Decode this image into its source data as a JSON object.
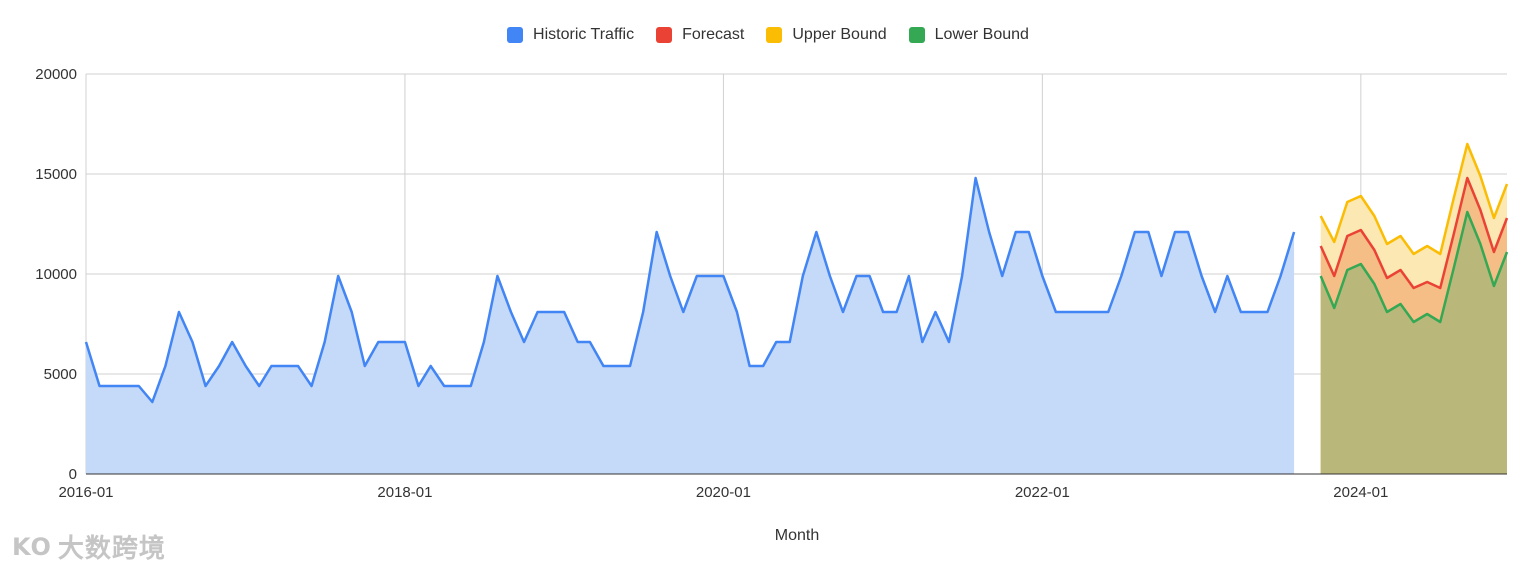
{
  "chart_data": {
    "type": "area",
    "xlabel": "Month",
    "ylabel": "",
    "ylim": [
      0,
      20000
    ],
    "yticks": [
      "0",
      "5000",
      "10000",
      "15000",
      "20000"
    ],
    "xticks": [
      "2016-01",
      "2018-01",
      "2020-01",
      "2022-01",
      "2024-01"
    ],
    "grid": true,
    "legend_position": "top",
    "series": [
      {
        "name": "Historic Traffic",
        "color": "#4285F4",
        "fill": "#C5D9F8",
        "x": [
          "2016-01",
          "2016-02",
          "2016-03",
          "2016-04",
          "2016-05",
          "2016-06",
          "2016-07",
          "2016-08",
          "2016-09",
          "2016-10",
          "2016-11",
          "2016-12",
          "2017-01",
          "2017-02",
          "2017-03",
          "2017-04",
          "2017-05",
          "2017-06",
          "2017-07",
          "2017-08",
          "2017-09",
          "2017-10",
          "2017-11",
          "2017-12",
          "2018-01",
          "2018-02",
          "2018-03",
          "2018-04",
          "2018-05",
          "2018-06",
          "2018-07",
          "2018-08",
          "2018-09",
          "2018-10",
          "2018-11",
          "2018-12",
          "2019-01",
          "2019-02",
          "2019-03",
          "2019-04",
          "2019-05",
          "2019-06",
          "2019-07",
          "2019-08",
          "2019-09",
          "2019-10",
          "2019-11",
          "2019-12",
          "2020-01",
          "2020-02",
          "2020-03",
          "2020-04",
          "2020-05",
          "2020-06",
          "2020-07",
          "2020-08",
          "2020-09",
          "2020-10",
          "2020-11",
          "2020-12",
          "2021-01",
          "2021-02",
          "2021-03",
          "2021-04",
          "2021-05",
          "2021-06",
          "2021-07",
          "2021-08",
          "2021-09",
          "2021-10",
          "2021-11",
          "2021-12",
          "2022-01",
          "2022-02",
          "2022-03",
          "2022-04",
          "2022-05",
          "2022-06",
          "2022-07",
          "2022-08",
          "2022-09",
          "2022-10",
          "2022-11",
          "2022-12",
          "2023-01",
          "2023-02",
          "2023-03",
          "2023-04",
          "2023-05",
          "2023-06",
          "2023-07",
          "2023-08"
        ],
        "values": [
          6600,
          4400,
          4400,
          4400,
          4400,
          3600,
          5400,
          8100,
          6600,
          4400,
          5400,
          6600,
          5400,
          4400,
          5400,
          5400,
          5400,
          4400,
          6600,
          9900,
          8100,
          5400,
          6600,
          6600,
          6600,
          4400,
          5400,
          4400,
          4400,
          4400,
          6600,
          9900,
          8100,
          6600,
          8100,
          8100,
          8100,
          6600,
          6600,
          5400,
          5400,
          5400,
          8100,
          12100,
          9900,
          8100,
          9900,
          9900,
          9900,
          8100,
          5400,
          5400,
          6600,
          6600,
          9900,
          12100,
          9900,
          8100,
          9900,
          9900,
          8100,
          8100,
          9900,
          6600,
          8100,
          6600,
          9900,
          14800,
          12100,
          9900,
          12100,
          12100,
          9900,
          8100,
          8100,
          8100,
          8100,
          8100,
          9900,
          12100,
          12100,
          9900,
          12100,
          12100,
          9900,
          8100,
          9900,
          8100,
          8100,
          8100,
          9900,
          12100
        ]
      },
      {
        "name": "Forecast",
        "color": "#EA4335",
        "fill": "#F5BE86",
        "x": [
          "2023-10",
          "2023-11",
          "2023-12",
          "2024-01",
          "2024-02",
          "2024-03",
          "2024-04",
          "2024-05",
          "2024-06",
          "2024-07",
          "2024-08",
          "2024-09",
          "2024-10",
          "2024-11",
          "2024-12"
        ],
        "values": [
          11400,
          9900,
          11900,
          12200,
          11200,
          9800,
          10200,
          9300,
          9600,
          9300,
          12000,
          14800,
          13200,
          11100,
          12800
        ]
      },
      {
        "name": "Upper Bound",
        "color": "#FBBC04",
        "fill": "#FCE8B2",
        "x": [
          "2023-10",
          "2023-11",
          "2023-12",
          "2024-01",
          "2024-02",
          "2024-03",
          "2024-04",
          "2024-05",
          "2024-06",
          "2024-07",
          "2024-08",
          "2024-09",
          "2024-10",
          "2024-11",
          "2024-12"
        ],
        "values": [
          12900,
          11600,
          13600,
          13900,
          12900,
          11500,
          11900,
          11000,
          11400,
          11000,
          13800,
          16500,
          14900,
          12800,
          14500
        ]
      },
      {
        "name": "Lower Bound",
        "color": "#34A853",
        "fill": "#B9B87A",
        "x": [
          "2023-10",
          "2023-11",
          "2023-12",
          "2024-01",
          "2024-02",
          "2024-03",
          "2024-04",
          "2024-05",
          "2024-06",
          "2024-07",
          "2024-08",
          "2024-09",
          "2024-10",
          "2024-11",
          "2024-12"
        ],
        "values": [
          9900,
          8300,
          10200,
          10500,
          9500,
          8100,
          8500,
          7600,
          8000,
          7600,
          10300,
          13100,
          11500,
          9400,
          11100
        ]
      }
    ]
  },
  "watermark": {
    "logo": "KO",
    "text": "大数跨境"
  }
}
